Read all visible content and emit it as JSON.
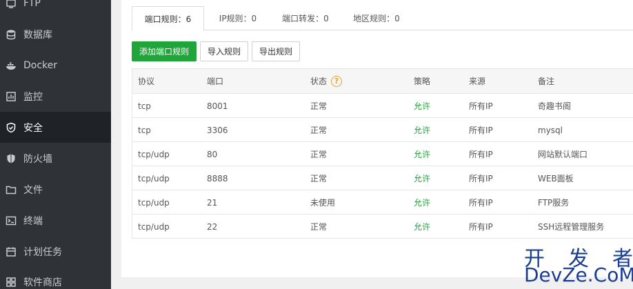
{
  "sidebar": {
    "items": [
      {
        "label": "FTP",
        "icon": "ftp-icon",
        "active": false
      },
      {
        "label": "数据库",
        "icon": "database-icon",
        "active": false
      },
      {
        "label": "Docker",
        "icon": "docker-icon",
        "active": false
      },
      {
        "label": "监控",
        "icon": "monitor-icon",
        "active": false
      },
      {
        "label": "安全",
        "icon": "shield-check-icon",
        "active": true
      },
      {
        "label": "防火墙",
        "icon": "firewall-shield-icon",
        "active": false
      },
      {
        "label": "文件",
        "icon": "folder-icon",
        "active": false
      },
      {
        "label": "终端",
        "icon": "terminal-icon",
        "active": false
      },
      {
        "label": "计划任务",
        "icon": "calendar-icon",
        "active": false
      },
      {
        "label": "软件商店",
        "icon": "grid-icon",
        "active": false
      }
    ]
  },
  "tabs": [
    {
      "label": "端口规则：6",
      "active": true
    },
    {
      "label": "IP规则：0",
      "active": false
    },
    {
      "label": "端口转发：0",
      "active": false
    },
    {
      "label": "地区规则：0",
      "active": false
    }
  ],
  "toolbar": {
    "add_label": "添加端口规则",
    "import_label": "导入规则",
    "export_label": "导出规则"
  },
  "table": {
    "headers": {
      "protocol": "协议",
      "port": "端口",
      "status": "状态",
      "policy": "策略",
      "source": "来源",
      "note": "备注"
    },
    "help_glyph": "?",
    "rows": [
      {
        "protocol": "tcp",
        "port": "8001",
        "status": "正常",
        "policy": "允许",
        "source": "所有IP",
        "note": "奇趣书阁"
      },
      {
        "protocol": "tcp",
        "port": "3306",
        "status": "正常",
        "policy": "允许",
        "source": "所有IP",
        "note": "mysql"
      },
      {
        "protocol": "tcp/udp",
        "port": "80",
        "status": "正常",
        "policy": "允许",
        "source": "所有IP",
        "note": "网站默认端口"
      },
      {
        "protocol": "tcp/udp",
        "port": "8888",
        "status": "正常",
        "policy": "允许",
        "source": "所有IP",
        "note": "WEB面板"
      },
      {
        "protocol": "tcp/udp",
        "port": "21",
        "status": "未使用",
        "policy": "允许",
        "source": "所有IP",
        "note": "FTP服务"
      },
      {
        "protocol": "tcp/udp",
        "port": "22",
        "status": "正常",
        "policy": "允许",
        "source": "所有IP",
        "note": "SSH远程管理服务"
      }
    ]
  },
  "watermark": {
    "chars": [
      "开",
      "发",
      "者"
    ],
    "domain": "DevZe.CoM"
  },
  "colors": {
    "accent_green": "#20a53a",
    "sidebar_bg": "#2f3237",
    "help_orange": "#f0a020",
    "watermark_blue": "#1a3d8f"
  }
}
